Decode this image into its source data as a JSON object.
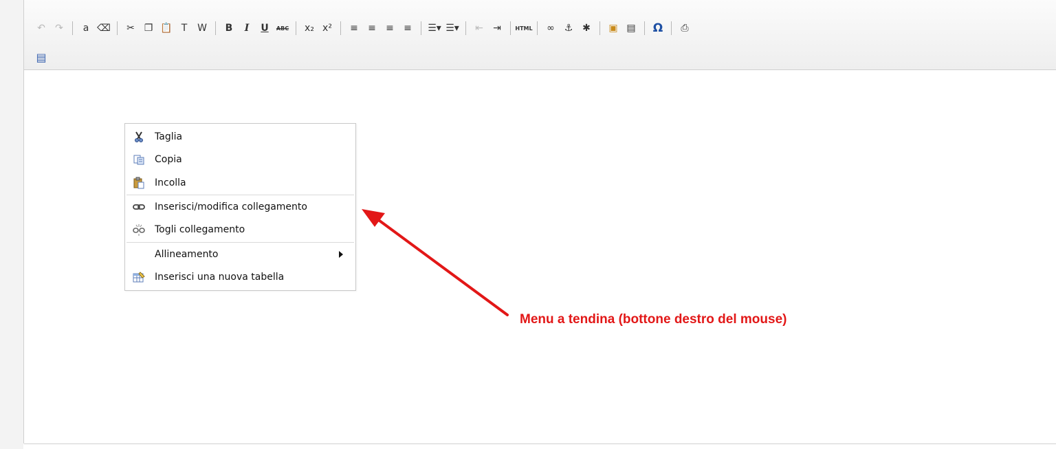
{
  "toolbar": {
    "buttons_row1": [
      {
        "icon": "undo-icon",
        "glyph": "↶",
        "dim": true
      },
      {
        "icon": "redo-icon",
        "glyph": "↷",
        "dim": true
      },
      {
        "sep": true
      },
      {
        "icon": "select-all-icon",
        "glyph": "a",
        "dim": false
      },
      {
        "icon": "remove-format-icon",
        "glyph": "⌫",
        "dim": false
      },
      {
        "sep": true
      },
      {
        "icon": "cut-icon",
        "glyph": "✂",
        "dim": false
      },
      {
        "icon": "copy-icon",
        "glyph": "❐",
        "dim": false
      },
      {
        "icon": "paste-icon",
        "glyph": "📋",
        "dim": false
      },
      {
        "icon": "paste-text-icon",
        "glyph": "T",
        "dim": false
      },
      {
        "icon": "paste-word-icon",
        "glyph": "W",
        "dim": false
      },
      {
        "sep": true
      },
      {
        "icon": "bold-icon",
        "glyph": "B",
        "dim": false
      },
      {
        "icon": "italic-icon",
        "glyph": "I",
        "dim": false
      },
      {
        "icon": "underline-icon",
        "glyph": "U",
        "dim": false
      },
      {
        "icon": "strikethrough-icon",
        "glyph": "ABC",
        "dim": false
      },
      {
        "sep": true
      },
      {
        "icon": "subscript-icon",
        "glyph": "x₂",
        "dim": false
      },
      {
        "icon": "superscript-icon",
        "glyph": "x²",
        "dim": false
      },
      {
        "sep": true
      },
      {
        "icon": "align-left-icon",
        "glyph": "≡",
        "dim": false
      },
      {
        "icon": "align-center-icon",
        "glyph": "≡",
        "dim": false
      },
      {
        "icon": "align-right-icon",
        "glyph": "≡",
        "dim": false
      },
      {
        "icon": "align-justify-icon",
        "glyph": "≡",
        "dim": false
      },
      {
        "sep": true
      },
      {
        "icon": "numbered-list-icon",
        "glyph": "☰▾",
        "dim": false
      },
      {
        "icon": "bulleted-list-icon",
        "glyph": "☰▾",
        "dim": false
      },
      {
        "sep": true
      },
      {
        "icon": "outdent-icon",
        "glyph": "⇤",
        "dim": true
      },
      {
        "icon": "indent-icon",
        "glyph": "⇥",
        "dim": false
      },
      {
        "sep": true
      },
      {
        "icon": "html-source-icon",
        "glyph": "HTML",
        "dim": false
      },
      {
        "sep": true
      },
      {
        "icon": "link-icon",
        "glyph": "∞",
        "dim": false
      },
      {
        "icon": "anchor-icon",
        "glyph": "⚓",
        "dim": false
      },
      {
        "icon": "unlink-icon",
        "glyph": "✱",
        "dim": false
      },
      {
        "sep": true
      },
      {
        "icon": "image-icon",
        "glyph": "▣",
        "dim": false
      },
      {
        "icon": "flash-icon",
        "glyph": "▤",
        "dim": false
      },
      {
        "sep": true
      },
      {
        "icon": "special-char-icon",
        "glyph": "Ω",
        "dim": false
      },
      {
        "sep": true
      },
      {
        "icon": "print-icon",
        "glyph": "⎙",
        "dim": false
      }
    ],
    "buttons_row2": [
      {
        "icon": "show-blocks-icon",
        "glyph": "▤",
        "dim": false
      }
    ]
  },
  "context_menu": {
    "items": [
      {
        "name": "taglia",
        "label": "Taglia",
        "icon": "scissors-icon"
      },
      {
        "name": "copia",
        "label": "Copia",
        "icon": "copy-icon"
      },
      {
        "name": "incolla",
        "label": "Incolla",
        "icon": "clipboard-icon"
      },
      {
        "name": "inserisci-collegamento",
        "label": "Inserisci/modifica collegamento",
        "icon": "link-icon"
      },
      {
        "name": "togli-collegamento",
        "label": "Togli collegamento",
        "icon": "unlink-icon"
      },
      {
        "name": "allineamento",
        "label": "Allineamento",
        "icon": "",
        "submenu": true
      },
      {
        "name": "inserisci-tabella",
        "label": "Inserisci una nuova tabella",
        "icon": "table-icon"
      }
    ]
  },
  "annotation": {
    "label": "Menu a tendina (bottone destro del mouse)",
    "color": "#e21717"
  },
  "colors": {
    "toolbar_bg": "#eeeeee",
    "border": "#cfcfcf",
    "annotation": "#e21717"
  }
}
